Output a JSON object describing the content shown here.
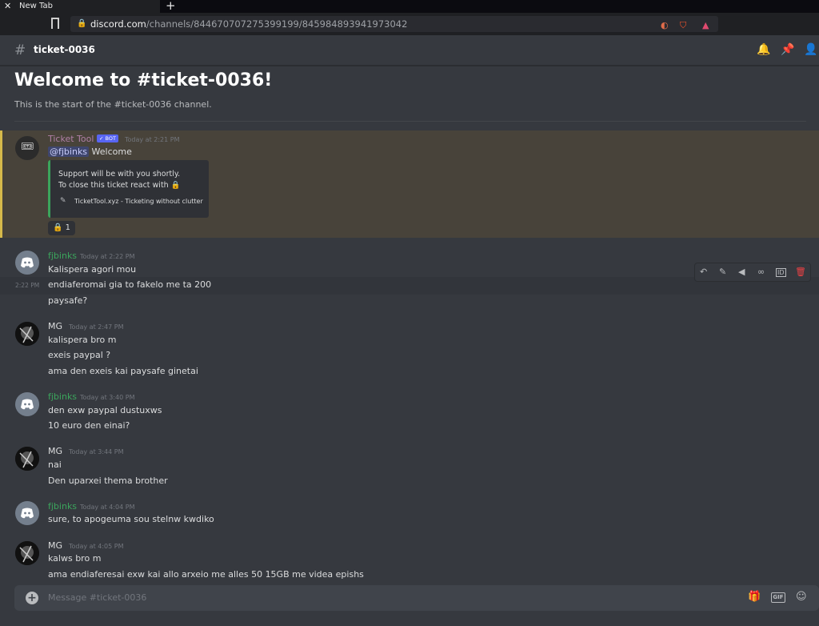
{
  "browser": {
    "tab_title": "New Tab",
    "tab_close": "✕",
    "new_tab": "+",
    "url_host": "discord.com",
    "url_path": "/channels/844670707275399199/845984893941973042"
  },
  "channel": {
    "name": "ticket-0036",
    "welcome_title": "Welcome to #ticket-0036!",
    "welcome_sub": "This is the start of the #ticket-0036 channel."
  },
  "bot_message": {
    "author": "Ticket Tool",
    "bot_tag": "✓ BOT",
    "time": "Today at 2:21 PM",
    "mention": "@fjbinks",
    "text": "Welcome",
    "embed_line1": "Support will be with you shortly.",
    "embed_line2": "To close this ticket react with 🔒",
    "embed_footer": "TicketTool.xyz - Ticketing without clutter",
    "reaction_emoji": "🔒",
    "reaction_count": "1"
  },
  "messages": [
    {
      "author": "fjbinks",
      "time": "Today at 2:22 PM",
      "lines": [
        "Kalispera agori mou",
        "endiaferomai gia to fakelo me ta 200",
        "paysafe?"
      ]
    },
    {
      "author": "MG",
      "time": "Today at 2:47 PM",
      "lines": [
        "kalispera bro m",
        "exeis paypal ?",
        "ama den exeis kai paysafe ginetai"
      ]
    },
    {
      "author": "fjbinks",
      "time": "Today at 3:40 PM",
      "lines": [
        "den exw paypal dustuxws",
        "10 euro den einai?"
      ]
    },
    {
      "author": "MG",
      "time": "Today at 3:44 PM",
      "lines": [
        "nai",
        "Den uparxei thema brother"
      ]
    },
    {
      "author": "fjbinks",
      "time": "Today at 4:04 PM",
      "lines": [
        "sure, to apogeuma sou stelnw kwdiko"
      ]
    },
    {
      "author": "MG",
      "time": "Today at 4:05 PM",
      "lines": [
        "kalws bro m",
        "ama endiaferesai exw kai allo arxeio me alles 50 15GB me videa epishs"
      ]
    }
  ],
  "hover_side_time": "2:22 PM",
  "composer": {
    "placeholder": "Message #ticket-0036",
    "gif_label": "GIF"
  },
  "colors": {
    "fjbinks": "#3ba55c",
    "mg": "#dcddde",
    "ticket_tool": "#b07fa6",
    "mention_highlight": "#48433a"
  }
}
